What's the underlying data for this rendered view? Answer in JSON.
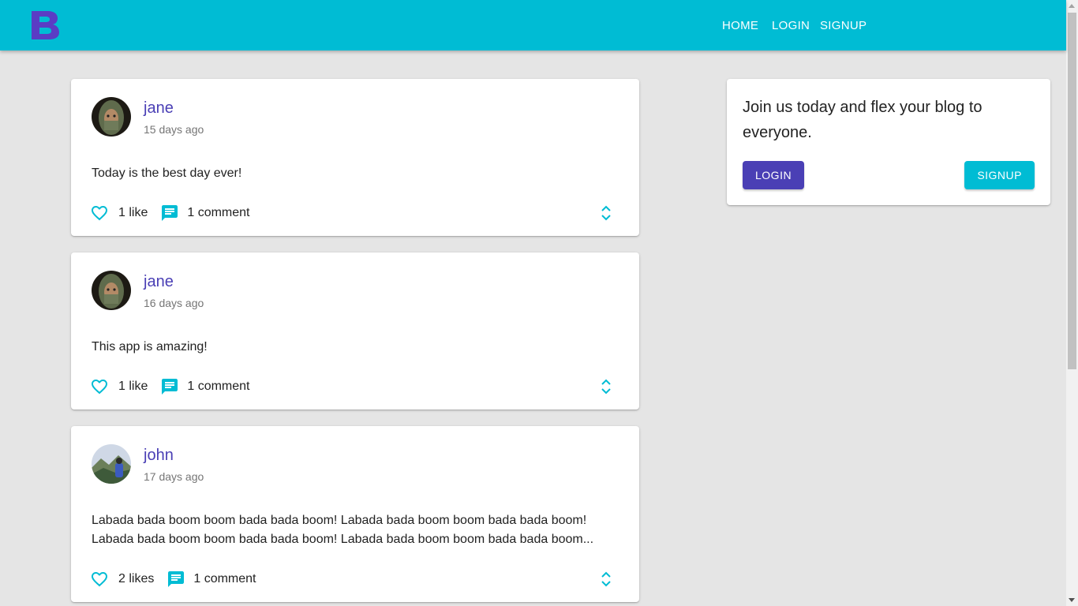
{
  "header": {
    "logo_letter": "B",
    "nav": [
      {
        "label": "Home"
      },
      {
        "label": "Login"
      },
      {
        "label": "Signup"
      }
    ]
  },
  "posts": [
    {
      "user": "jane",
      "date": "15 days ago",
      "body": "Today is the best day ever!",
      "likes": "1 like",
      "comments": "1 comment"
    },
    {
      "user": "jane",
      "date": "16 days ago",
      "body": "This app is amazing!",
      "likes": "1 like",
      "comments": "1 comment"
    },
    {
      "user": "john",
      "date": "17 days ago",
      "body": "Labada bada boom boom bada bada boom! Labada bada boom boom bada bada boom! Labada bada boom boom bada bada boom! Labada bada boom boom bada bada boom...",
      "likes": "2 likes",
      "comments": "1 comment"
    }
  ],
  "sidebar": {
    "text": "Join us today and flex your blog to everyone.",
    "login_label": "Login",
    "signup_label": "Signup"
  },
  "colors": {
    "appbar": "#00bcd4",
    "primary": "#4a3fb5",
    "accent": "#00bcd4",
    "background": "#e5e5e5"
  },
  "icons": [
    "logo-icon",
    "heart-outline-icon",
    "chat-icon",
    "unfold-more-icon"
  ]
}
